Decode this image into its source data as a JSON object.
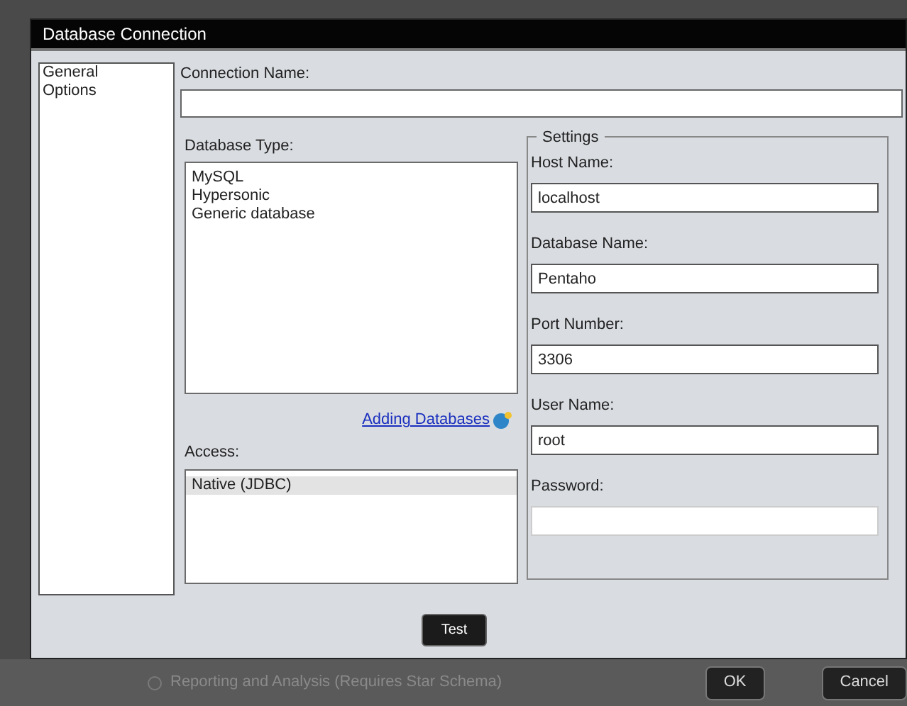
{
  "window": {
    "title": "Database Connection"
  },
  "nav": [
    {
      "label": "General"
    },
    {
      "label": "Options"
    }
  ],
  "connection_name": {
    "label": "Connection Name:"
  },
  "database_type": {
    "label": "Database Type:",
    "items": [
      {
        "label": "MySQL",
        "selected": false
      },
      {
        "label": "Hypersonic",
        "selected": false
      },
      {
        "label": "Generic database",
        "selected": false
      }
    ]
  },
  "help_link": "Adding Databases",
  "access": {
    "label": "Access:",
    "items": [
      {
        "label": "Native (JDBC)",
        "selected": true
      }
    ]
  },
  "settings": {
    "title": "Settings",
    "fields": [
      {
        "label": "Host Name:",
        "value": "localhost"
      },
      {
        "label": "Database Name:",
        "value": "Pentaho"
      },
      {
        "label": "Port Number:",
        "value": "3306"
      },
      {
        "label": "User Name:",
        "value": "root"
      },
      {
        "label": "Password:"
      }
    ]
  },
  "test_button": "Test",
  "background_option": {
    "label": "Reporting and Analysis (Requires Star Schema)",
    "checked": false
  },
  "buttons": [
    "OK",
    "Cancel"
  ]
}
